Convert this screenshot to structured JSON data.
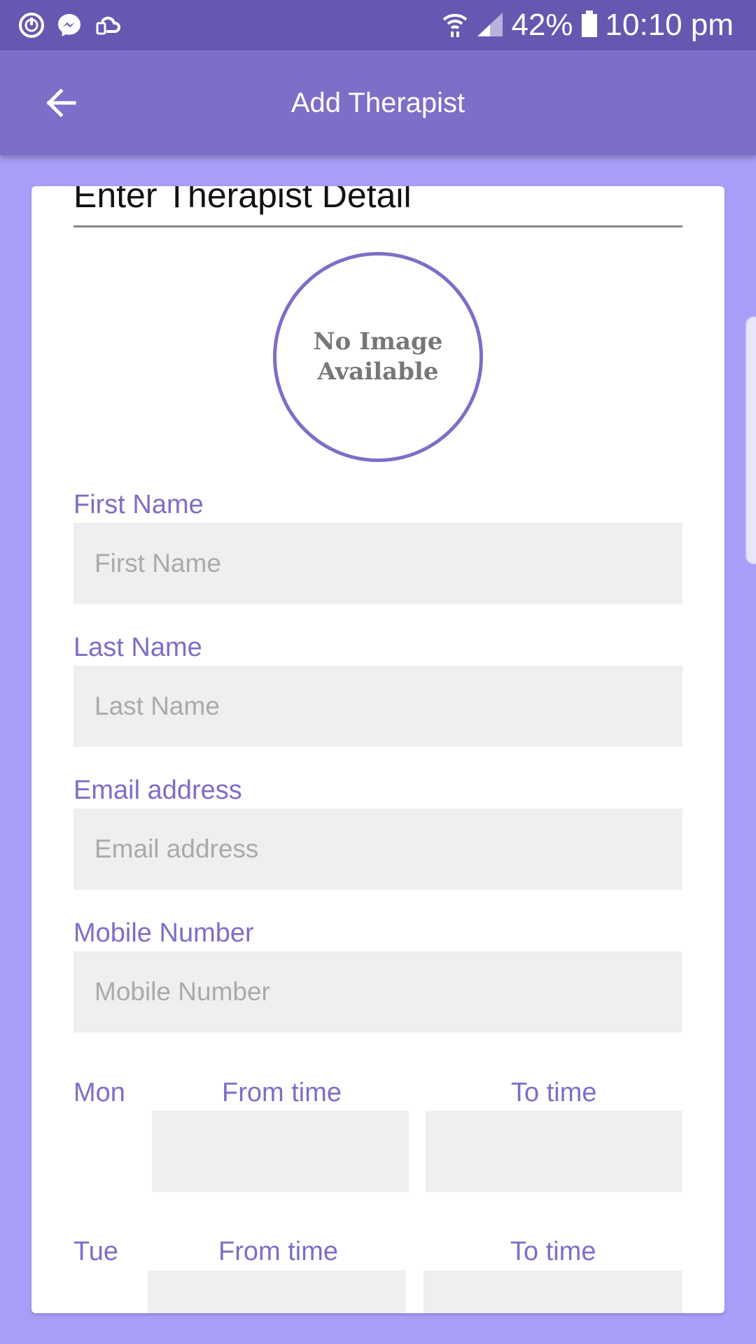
{
  "status_bar": {
    "battery": "42%",
    "time": "10:10 pm",
    "left_icons": [
      "timer-app-icon",
      "messenger-icon",
      "cloud-sync-icon"
    ],
    "right_icons": [
      "wifi-icon",
      "cellular-signal-icon",
      "battery-icon"
    ]
  },
  "app_bar": {
    "title": "Add Therapist",
    "back_icon": "arrow-left-icon"
  },
  "form": {
    "section_title": "Enter Therapist Detail",
    "avatar_text_line1": "No Image",
    "avatar_text_line2": "Available",
    "first_name": {
      "label": "First Name",
      "placeholder": "First Name",
      "value": ""
    },
    "last_name": {
      "label": "Last Name",
      "placeholder": "Last Name",
      "value": ""
    },
    "email": {
      "label": "Email address",
      "placeholder": "Email address",
      "value": ""
    },
    "mobile": {
      "label": "Mobile Number",
      "placeholder": "Mobile Number",
      "value": ""
    },
    "schedule": [
      {
        "day": "Mon",
        "from_label": "From time",
        "to_label": "To time"
      },
      {
        "day": "Tue",
        "from_label": "From time",
        "to_label": "To time"
      }
    ]
  },
  "colors": {
    "status_bar": "#6558b0",
    "app_bar": "#7b6fc7",
    "background": "#a89ef8",
    "accent": "#7b6fc7",
    "input_bg": "#efefef"
  }
}
